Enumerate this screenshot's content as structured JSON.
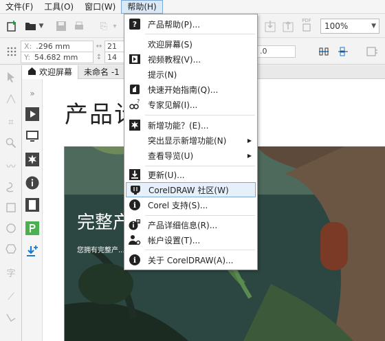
{
  "menubar": {
    "items": [
      "文件(F)",
      "工具(O)",
      "窗口(W)",
      "帮助(H)"
    ]
  },
  "toolbar": {
    "zoom": "100%",
    "x_label": "X:",
    "y_label": "Y:",
    "x_value": ".296 mm",
    "y_value": "54.682 mm",
    "w_value": "21",
    "h_value": "14",
    "field_value": ".0",
    "pdf_label": "PDF"
  },
  "tabs": {
    "welcome": "欢迎屏幕",
    "untitled": "未命名 -1"
  },
  "welcome": {
    "title": "产品计",
    "hero_title": "完整产",
    "hero_sub": "您拥有完整产..."
  },
  "help_menu": {
    "items": [
      {
        "label": "产品帮助(P)...",
        "icon": "help-book-icon"
      },
      {
        "label": "欢迎屏幕(S)",
        "icon": ""
      },
      {
        "label": "视频教程(V)...",
        "icon": "film-icon"
      },
      {
        "label": "提示(N)",
        "icon": ""
      },
      {
        "label": "快速开始指南(Q)...",
        "icon": "quickstart-icon"
      },
      {
        "label": "专家见解(I)...",
        "icon": "expert-icon"
      },
      {
        "label": "新增功能？(E)...",
        "icon": "star-burst-icon"
      },
      {
        "label": "突出显示新增功能(N)",
        "icon": ""
      },
      {
        "label": "查看导览(U)",
        "icon": ""
      },
      {
        "label": "更新(U)...",
        "icon": "download-icon"
      },
      {
        "label": "CorelDRAW 社区(W)",
        "icon": "coreldraw-balloon-icon"
      },
      {
        "label": "Corel 支持(S)...",
        "icon": "info-icon"
      },
      {
        "label": "产品详细信息(R)...",
        "icon": "product-info-icon"
      },
      {
        "label": "帐户设置(T)...",
        "icon": "account-icon"
      },
      {
        "label": "关于 CorelDRAW(A)...",
        "icon": "about-icon"
      }
    ]
  },
  "colors": {
    "highlight": "#e5f0fb",
    "highlight_border": "#7aa7d6",
    "hero_bg": "#2f4d48",
    "accent_green": "#4caf50",
    "accent_blue": "#1a7bd1"
  }
}
